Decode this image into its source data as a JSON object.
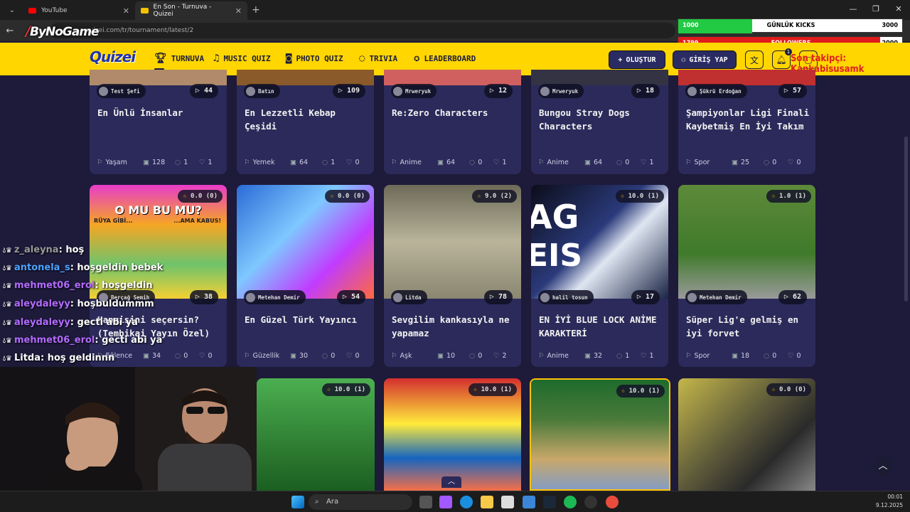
{
  "browser": {
    "tabs": [
      {
        "label": "YouTube",
        "favicon_color": "#ff0000"
      },
      {
        "label": "En Son - Turnuva - Quizei",
        "favicon_color": "#f2c200"
      }
    ],
    "url": "quizei.com/tr/tournament/latest/2",
    "brand_watermark": "ByNoGame"
  },
  "overlay": {
    "kicks": {
      "current": "1000",
      "label": "GÜNLÜK KICKS",
      "goal": "3000",
      "fraction": 0.33
    },
    "followers": {
      "current": "1799",
      "label": "FOLLOWERS",
      "goal": "2000",
      "fraction": 0.9
    },
    "last_follower": "Son takipçi: Kankabisusamk"
  },
  "nav": {
    "logo": "Quizei",
    "items": [
      "TURNUVA",
      "MUSIC QUIZ",
      "PHOTO QUIZ",
      "TRIVIA",
      "LEADERBOARD"
    ],
    "create": "OLUŞTUR",
    "login": "GİRİŞ YAP",
    "notif_count": "1"
  },
  "row1": [
    {
      "author": "Test Şefi",
      "plays": "44",
      "title": "En Ünlü İnsanlar",
      "category": "Yaşam",
      "items": "128",
      "comments": "1",
      "likes": "1"
    },
    {
      "author": "Batın",
      "plays": "109",
      "title": "En Lezzetli Kebap Çeşidi",
      "category": "Yemek",
      "items": "64",
      "comments": "1",
      "likes": "0"
    },
    {
      "author": "Mrweryuk",
      "plays": "12",
      "title": "Re:Zero Characters",
      "category": "Anime",
      "items": "64",
      "comments": "0",
      "likes": "1"
    },
    {
      "author": "Mrweryuk",
      "plays": "18",
      "title": "Bungou Stray Dogs Characters",
      "category": "Anime",
      "items": "64",
      "comments": "0",
      "likes": "1"
    },
    {
      "author": "Şükrü Erdoğan",
      "plays": "57",
      "title": "Şampiyonlar Ligi Finali Kaybetmiş En İyi Takım",
      "category": "Spor",
      "items": "25",
      "comments": "0",
      "likes": "0"
    }
  ],
  "row2": [
    {
      "rating": "0.0",
      "votes": "(0)",
      "author": "Berçağ Semih",
      "plays": "38",
      "title": "Hangisini seçersin? (Tembikai Yayın Özel)",
      "category": "Eğlence",
      "items": "34",
      "comments": "0",
      "likes": "0",
      "thumb_text_1": "O MU BU MU?",
      "thumb_text_2": "RÜYA GİBİ...",
      "thumb_text_3": "...AMA KABUS!"
    },
    {
      "rating": "0.0",
      "votes": "(0)",
      "author": "Metehan Demir",
      "plays": "54",
      "title": "En Güzel Türk Yayıncı",
      "category": "Güzellik",
      "items": "30",
      "comments": "0",
      "likes": "0"
    },
    {
      "rating": "9.0",
      "votes": "(2)",
      "author": "Litda",
      "plays": "78",
      "title": "Sevgilim kankasıyla ne yapamaz",
      "category": "Aşk",
      "items": "10",
      "comments": "0",
      "likes": "2"
    },
    {
      "rating": "10.0",
      "votes": "(1)",
      "author": "halil tosun",
      "plays": "17",
      "title": "EN İYİ BLUE LOCK ANİME KARAKTERİ",
      "category": "Anime",
      "items": "32",
      "comments": "1",
      "likes": "1",
      "thumb_text_1": "AG",
      "thumb_text_2": "EIS"
    },
    {
      "rating": "1.0",
      "votes": "(1)",
      "author": "Metehan Demir",
      "plays": "62",
      "title": "Süper Lig'e gelmiş en iyi forvet",
      "category": "Spor",
      "items": "18",
      "comments": "0",
      "likes": "0"
    }
  ],
  "row3": [
    {
      "rating": "10.0",
      "votes": "(1)"
    },
    {
      "rating": "10.0",
      "votes": "(1)"
    },
    {
      "rating": "10.0",
      "votes": "(1)"
    },
    {
      "rating": "0.0",
      "votes": "(0)"
    }
  ],
  "chat": [
    {
      "user": "z_aleyna",
      "message": ": hoş",
      "color": "#9a9a9a"
    },
    {
      "user": "antonela_s",
      "message": ": hoşgeldin bebek",
      "color": "#4da3ff"
    },
    {
      "user": "mehmet06_erol",
      "message": ": hoşgeldin",
      "color": "#b36bff"
    },
    {
      "user": "aleydaleyy",
      "message": ": hoşbuldummm",
      "color": "#b36bff"
    },
    {
      "user": "aleydaleyy",
      "message": ": gecti abi ya",
      "color": "#b36bff"
    },
    {
      "user": "mehmet06_erol",
      "message": ": gecti abi ya",
      "color": "#b36bff"
    },
    {
      "user": "Litda",
      "message": ": hoş geldinnn",
      "color": "#ffffff"
    }
  ],
  "taskbar": {
    "search": "Ara",
    "time": "00:01",
    "date": "9.12.2025"
  },
  "colors": {
    "nav_bg": "#ffd600",
    "page_bg": "#1d1a3a",
    "card_bg": "#2b2a5a",
    "accent": "#2a2b63"
  }
}
